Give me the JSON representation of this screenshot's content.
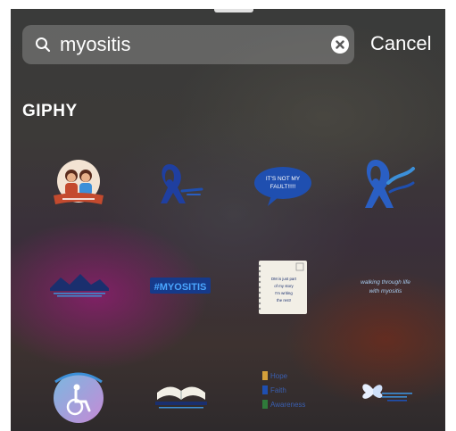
{
  "search": {
    "value": "myositis",
    "clear_icon": "clear-circle-icon",
    "search_icon": "magnifier-icon"
  },
  "cancel_label": "Cancel",
  "section": {
    "title": "GIPHY"
  },
  "colors": {
    "ribbon_blue": "#1f4fb0",
    "navy": "#1a2f6e",
    "light_blue": "#3c8fd8",
    "cream": "#f2efe6",
    "brick": "#c44a2e"
  },
  "stickers": [
    {
      "kind": "illustration-two-people-banner"
    },
    {
      "kind": "blue-ribbon-small"
    },
    {
      "kind": "speech-bubble",
      "text_lines": [
        "IT'S NOT MY",
        "FAULT!!!!!"
      ]
    },
    {
      "kind": "blue-ribbon-large"
    },
    {
      "kind": "mountains-text-banner"
    },
    {
      "kind": "myositis-block-text",
      "text": "#MYOSITIS"
    },
    {
      "kind": "notepad",
      "text_lines": [
        "DM is just part",
        "of my story",
        "I'm writing",
        "the rest!"
      ]
    },
    {
      "kind": "script-text",
      "text_lines": [
        "walking through life",
        "with myositis"
      ]
    },
    {
      "kind": "wheelchair-circle"
    },
    {
      "kind": "book-banner"
    },
    {
      "kind": "awareness-list",
      "text_lines": [
        "Hope",
        "Faith",
        "Awareness"
      ]
    },
    {
      "kind": "butterfly-text"
    }
  ]
}
